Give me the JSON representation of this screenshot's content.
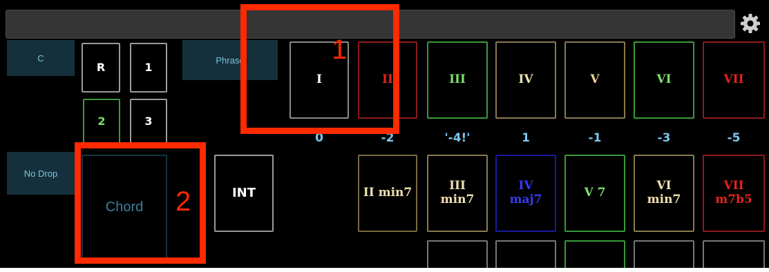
{
  "settings_icon": "gear-icon",
  "key_panel": {
    "label": "C"
  },
  "phrase_panel": {
    "label": "Phrase"
  },
  "drop_panel": {
    "label": "No Drop"
  },
  "inversion_buttons": [
    "R",
    "1",
    "2",
    "3"
  ],
  "chord_pad": {
    "label": "Chord"
  },
  "int_button": {
    "label": "INT"
  },
  "triad_row": [
    {
      "label": "I",
      "color": "#8a8a8a",
      "text_color": "#ffffff"
    },
    {
      "label": "II",
      "color": "#8e1a1a",
      "text_color": "#e0241b"
    },
    {
      "label": "III",
      "color": "#3a9a3a",
      "text_color": "#7ce06a"
    },
    {
      "label": "IV",
      "color": "#8a7a52",
      "text_color": "#f0e0b0"
    },
    {
      "label": "V",
      "color": "#8a7a52",
      "text_color": "#f0d890"
    },
    {
      "label": "VI",
      "color": "#3a9a3a",
      "text_color": "#7ce06a"
    },
    {
      "label": "VII",
      "color": "#8e1a1a",
      "text_color": "#e0241b"
    }
  ],
  "offsets": [
    "0",
    "-2",
    "'-4!'",
    "1",
    "-1",
    "-3",
    "-5"
  ],
  "seventh_row": [
    {
      "line1": "II min7",
      "line2": "",
      "color": "#7a6a42",
      "text_color": "#f0e0b0"
    },
    {
      "line1": "III",
      "line2": "min7",
      "color": "#8a7a52",
      "text_color": "#f0e0b0"
    },
    {
      "line1": "IV",
      "line2": "maj7",
      "color": "#1a1aa0",
      "text_color": "#3a3af0"
    },
    {
      "line1": "V 7",
      "line2": "",
      "color": "#3a9a3a",
      "text_color": "#7ce06a"
    },
    {
      "line1": "VI",
      "line2": "min7",
      "color": "#8a7a52",
      "text_color": "#f0e0b0"
    },
    {
      "line1": "VII",
      "line2": "m7b5",
      "color": "#8e1a1a",
      "text_color": "#e0241b"
    }
  ],
  "annotations": [
    "1",
    "2"
  ],
  "colors": {
    "annotation": "#ff2a00",
    "panel": "#15303d",
    "panel_text": "#7ec4d8"
  }
}
